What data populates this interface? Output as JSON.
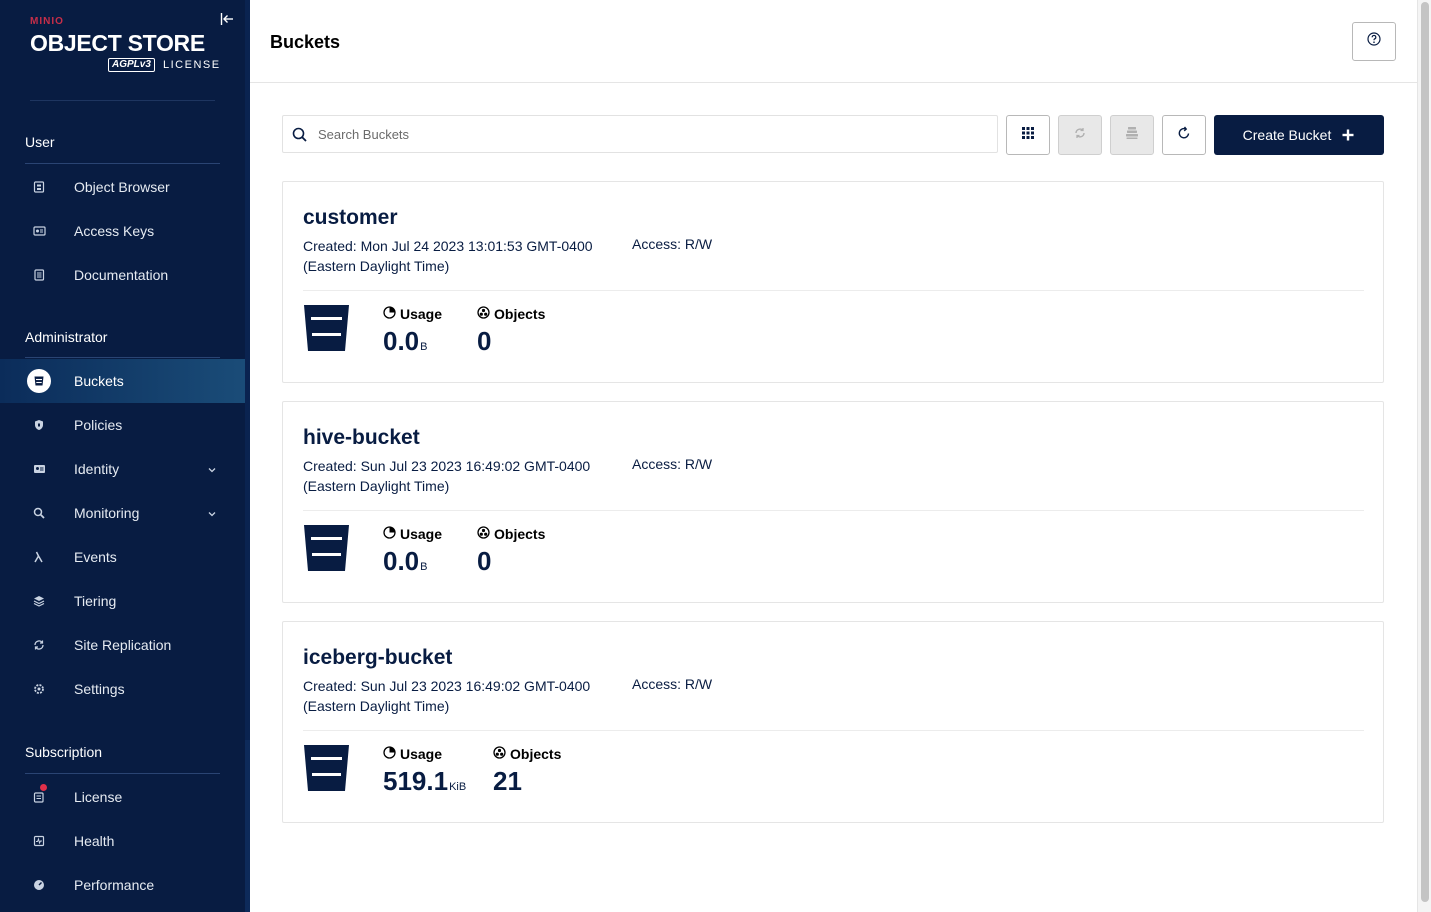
{
  "brand": {
    "minio": "MINIO",
    "product": "OBJECT STORE",
    "agpl": "AGPLv3",
    "license": "LICENSE"
  },
  "sidebar": {
    "sections": [
      {
        "title": "User"
      },
      {
        "title": "Administrator"
      },
      {
        "title": "Subscription"
      }
    ],
    "user_items": [
      {
        "label": "Object Browser",
        "icon": "object-browser-icon"
      },
      {
        "label": "Access Keys",
        "icon": "access-keys-icon"
      },
      {
        "label": "Documentation",
        "icon": "documentation-icon"
      }
    ],
    "admin_items": [
      {
        "label": "Buckets",
        "icon": "bucket-icon",
        "active": true
      },
      {
        "label": "Policies",
        "icon": "policies-icon"
      },
      {
        "label": "Identity",
        "icon": "identity-icon",
        "expandable": true
      },
      {
        "label": "Monitoring",
        "icon": "monitoring-icon",
        "expandable": true
      },
      {
        "label": "Events",
        "icon": "lambda-icon"
      },
      {
        "label": "Tiering",
        "icon": "tiering-icon"
      },
      {
        "label": "Site Replication",
        "icon": "site-replication-icon"
      },
      {
        "label": "Settings",
        "icon": "settings-icon"
      }
    ],
    "subscription_items": [
      {
        "label": "License",
        "icon": "license-icon",
        "badge": true
      },
      {
        "label": "Health",
        "icon": "health-icon"
      },
      {
        "label": "Performance",
        "icon": "performance-icon"
      }
    ]
  },
  "header": {
    "title": "Buckets"
  },
  "toolbar": {
    "search_placeholder": "Search Buckets",
    "create_label": "Create Bucket"
  },
  "buckets": [
    {
      "name": "customer",
      "created": "Created: Mon Jul 24 2023 13:01:53 GMT-0400 (Eastern Daylight Time)",
      "access": "Access: R/W",
      "usage_label": "Usage",
      "usage_value": "0.0",
      "usage_unit": "B",
      "objects_label": "Objects",
      "objects_value": "0"
    },
    {
      "name": "hive-bucket",
      "created": "Created: Sun Jul 23 2023 16:49:02 GMT-0400 (Eastern Daylight Time)",
      "access": "Access: R/W",
      "usage_label": "Usage",
      "usage_value": "0.0",
      "usage_unit": "B",
      "objects_label": "Objects",
      "objects_value": "0"
    },
    {
      "name": "iceberg-bucket",
      "created": "Created: Sun Jul 23 2023 16:49:02 GMT-0400 (Eastern Daylight Time)",
      "access": "Access: R/W",
      "usage_label": "Usage",
      "usage_value": "519.1",
      "usage_unit": "KiB",
      "objects_label": "Objects",
      "objects_value": "21"
    }
  ]
}
